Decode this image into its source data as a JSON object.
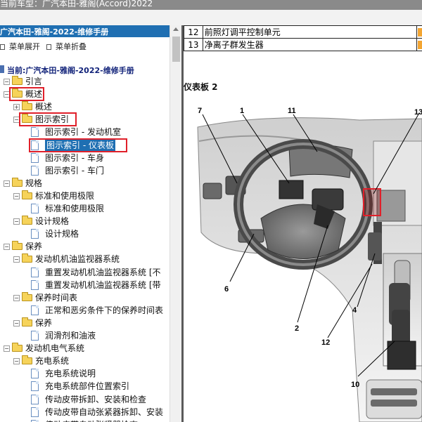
{
  "window": {
    "title": "当前车型：广汽本田-雅阁(Accord)2022"
  },
  "tree": {
    "header": "广汽本田-雅阁-2022-维修手册",
    "expand_all": "菜单展开",
    "collapse_all": "菜单折叠",
    "current": "当前:广汽本田-雅阁-2022-维修手册",
    "items": [
      {
        "label": "引言",
        "type": "folder",
        "level": 0
      },
      {
        "label": "概述",
        "type": "folder",
        "level": 0,
        "highlighted": true
      },
      {
        "label": "概述",
        "type": "folder",
        "level": 1
      },
      {
        "label": "图示索引",
        "type": "folder",
        "level": 1,
        "highlighted": true
      },
      {
        "label": "图示索引 - 发动机室",
        "type": "doc",
        "level": 2
      },
      {
        "label": "图示索引 - 仪表板",
        "type": "doc",
        "level": 2,
        "selected": true,
        "highlighted": true
      },
      {
        "label": "图示索引 - 车身",
        "type": "doc",
        "level": 2
      },
      {
        "label": "图示索引 - 车门",
        "type": "doc",
        "level": 2
      },
      {
        "label": "规格",
        "type": "folder",
        "level": 0
      },
      {
        "label": "标准和使用极限",
        "type": "folder",
        "level": 1
      },
      {
        "label": "标准和使用极限",
        "type": "doc",
        "level": 2
      },
      {
        "label": "设计规格",
        "type": "folder",
        "level": 1
      },
      {
        "label": "设计规格",
        "type": "doc",
        "level": 2
      },
      {
        "label": "保养",
        "type": "folder",
        "level": 0
      },
      {
        "label": "发动机机油监视器系统",
        "type": "folder",
        "level": 1
      },
      {
        "label": "重置发动机机油监视器系统 [不",
        "type": "doc",
        "level": 2
      },
      {
        "label": "重置发动机机油监视器系统 [带",
        "type": "doc",
        "level": 2
      },
      {
        "label": "保养时间表",
        "type": "folder",
        "level": 1
      },
      {
        "label": "正常和恶劣条件下的保养时间表",
        "type": "doc",
        "level": 2
      },
      {
        "label": "保养",
        "type": "folder",
        "level": 1
      },
      {
        "label": "润滑剂和油液",
        "type": "doc",
        "level": 2
      },
      {
        "label": "发动机电气系统",
        "type": "folder",
        "level": 0
      },
      {
        "label": "充电系统",
        "type": "folder",
        "level": 1
      },
      {
        "label": "充电系统说明",
        "type": "doc",
        "level": 2
      },
      {
        "label": "充电系统部件位置索引",
        "type": "doc",
        "level": 2
      },
      {
        "label": "传动皮带拆卸、安装和检查",
        "type": "doc",
        "level": 2
      },
      {
        "label": "传动皮带自动张紧器拆卸、安装",
        "type": "doc",
        "level": 2
      },
      {
        "label": "传动皮带自动张紧器检查",
        "type": "doc",
        "level": 2
      }
    ]
  },
  "content": {
    "table_rows": [
      {
        "num": "12",
        "name": "前照灯调平控制单元"
      },
      {
        "num": "13",
        "name": "净离子群发生器"
      }
    ],
    "panel_title": "仪表板 2",
    "callouts": [
      "1",
      "2",
      "4",
      "6",
      "7",
      "10",
      "11",
      "12",
      "13"
    ]
  },
  "colors": {
    "header_bg": "#1f6fb2",
    "highlight_red": "#e0202a",
    "selected_bg": "#1f6fb2",
    "folder_yellow": "#f6d35a"
  }
}
